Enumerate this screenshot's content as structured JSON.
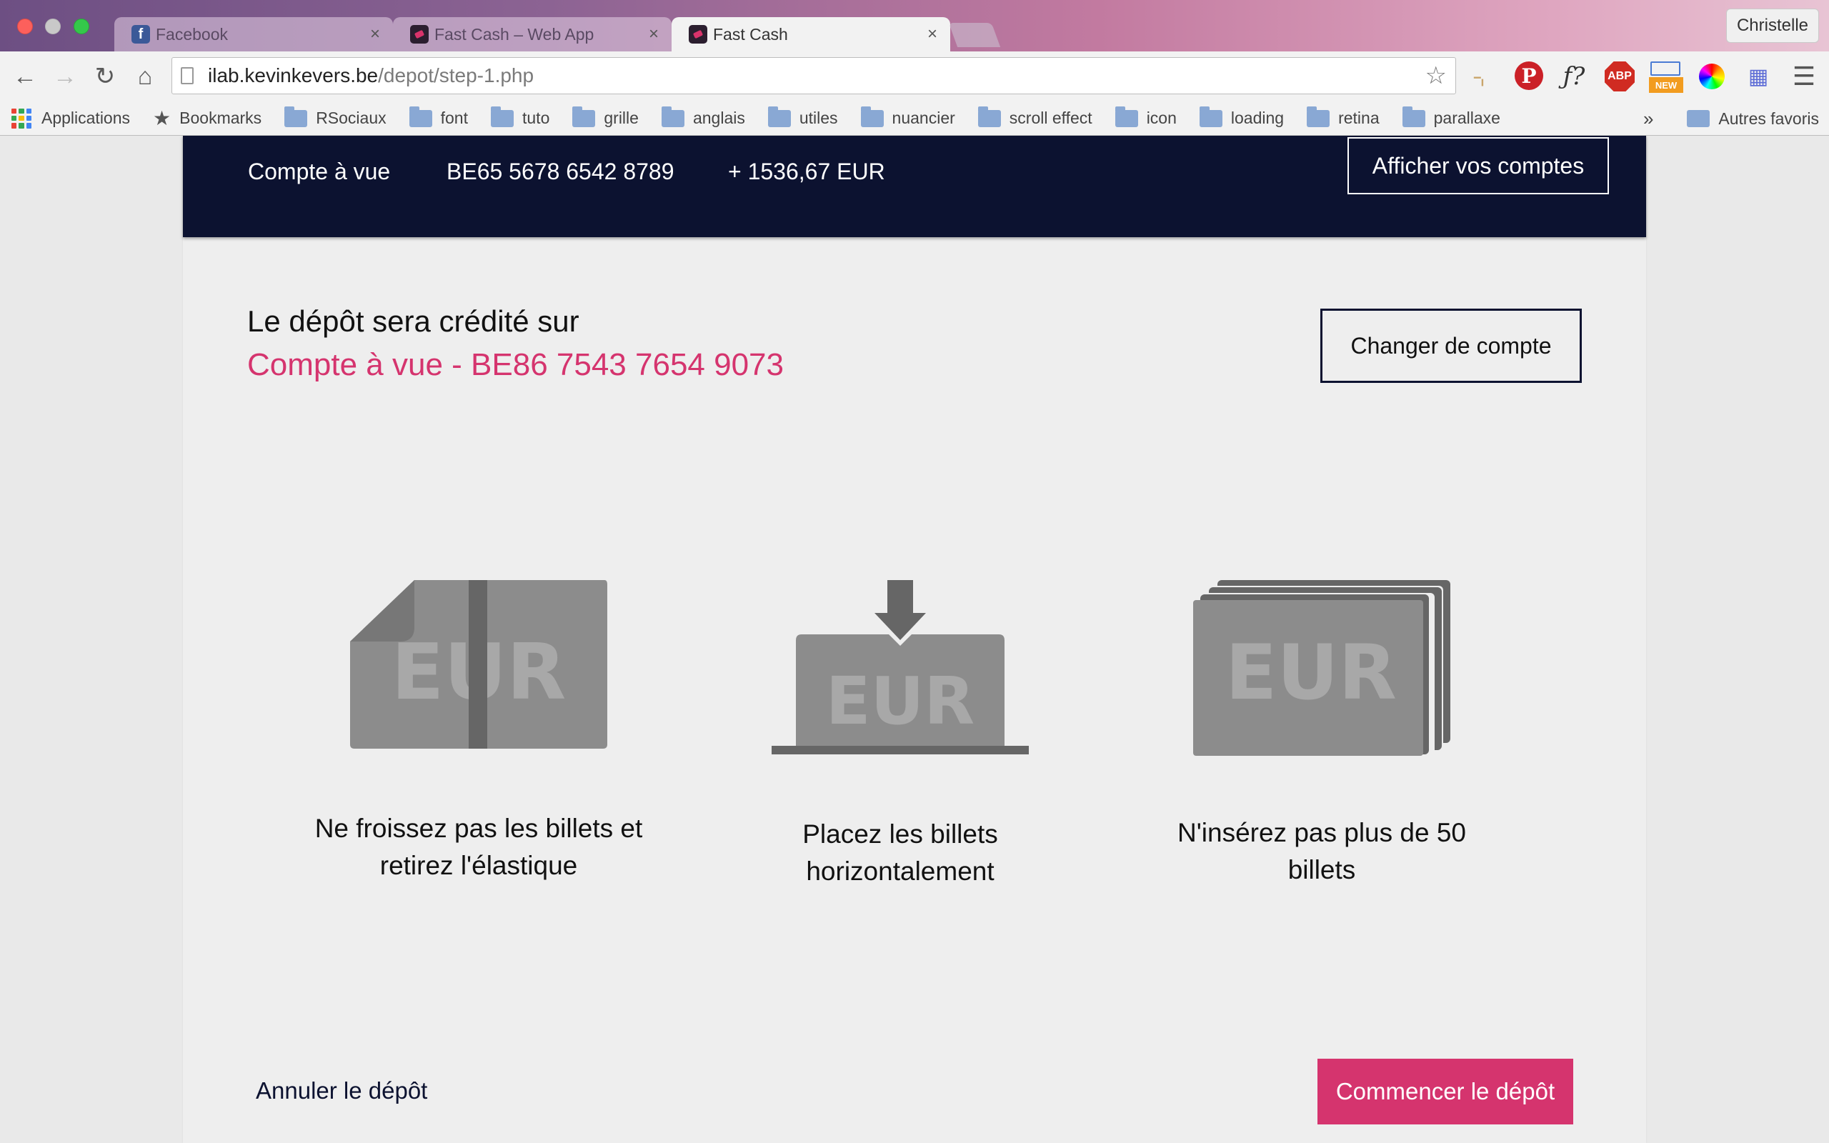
{
  "browser": {
    "tabs": [
      {
        "title": "Facebook",
        "icon": "facebook-icon",
        "active": false
      },
      {
        "title": "Fast Cash – Web App",
        "icon": "fastcash-icon",
        "active": false
      },
      {
        "title": "Fast Cash",
        "icon": "fastcash-icon",
        "active": true
      }
    ],
    "close_glyph": "×",
    "profile_name": "Christelle",
    "url_host": "ilab.kevinkevers.be",
    "url_path": "/depot/step-1.php",
    "bookmarks": [
      {
        "label": "Applications",
        "type": "apps"
      },
      {
        "label": "Bookmarks",
        "type": "star"
      },
      {
        "label": "RSociaux",
        "type": "folder"
      },
      {
        "label": "font",
        "type": "folder"
      },
      {
        "label": "tuto",
        "type": "folder"
      },
      {
        "label": "grille",
        "type": "folder"
      },
      {
        "label": "anglais",
        "type": "folder"
      },
      {
        "label": "utiles",
        "type": "folder"
      },
      {
        "label": "nuancier",
        "type": "folder"
      },
      {
        "label": "scroll effect",
        "type": "folder"
      },
      {
        "label": "icon",
        "type": "folder"
      },
      {
        "label": "loading",
        "type": "folder"
      },
      {
        "label": "retina",
        "type": "folder"
      },
      {
        "label": "parallaxe",
        "type": "folder"
      }
    ],
    "bookmarks_more": "»",
    "other_bookmarks": "Autres favoris",
    "extensions": {
      "font_label": "ƒ?",
      "abp_label": "ABP",
      "new_badge": "NEW",
      "pinterest_label": "P"
    }
  },
  "account_bar": {
    "type": "Compte à vue",
    "iban": "BE65 5678 6542 8789",
    "balance": "+ 1536,67 EUR",
    "button": "Afficher vos comptes"
  },
  "credit": {
    "title": "Le dépôt sera crédité sur",
    "account": "Compte à vue - BE86 7543 7654 9073",
    "change_button": "Changer de compte"
  },
  "steps": [
    {
      "icon": "banknote-elastic-icon",
      "icon_text": "EUR",
      "caption_line1": "Ne froissez pas les billets et",
      "caption_line2": "retirez l'élastique"
    },
    {
      "icon": "banknote-insert-icon",
      "icon_text": "EUR",
      "caption_line1": "Placez les billets",
      "caption_line2": "horizontalement"
    },
    {
      "icon": "banknote-stack-icon",
      "icon_text": "EUR",
      "caption_line1": "N'insérez pas plus de 50",
      "caption_line2": "billets"
    }
  ],
  "actions": {
    "cancel": "Annuler le dépôt",
    "start": "Commencer le dépôt"
  },
  "colors": {
    "navy": "#0c1230",
    "accent": "#d5346e",
    "icon_gray": "#8c8c8c",
    "icon_dark": "#666666"
  }
}
